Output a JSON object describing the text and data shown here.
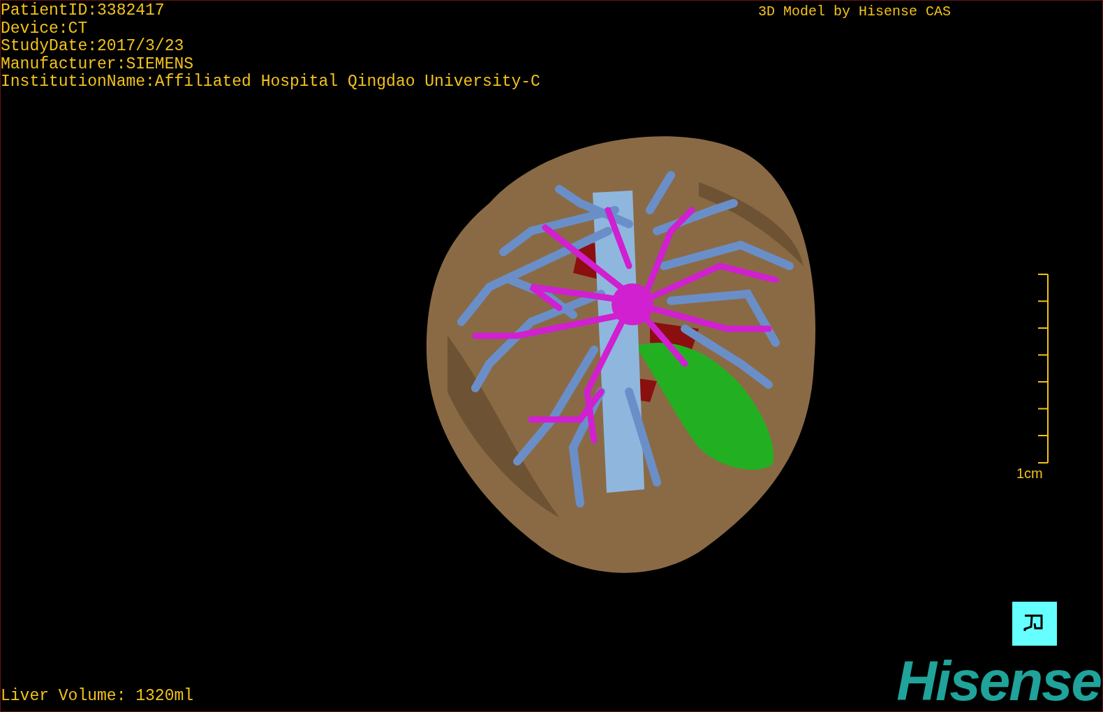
{
  "info_lines": [
    "PatientID:3382417",
    "Device:CT",
    "StudyDate:2017/3/23",
    "Manufacturer:SIEMENS",
    "InstitutionName:Affiliated Hospital Qingdao University-C"
  ],
  "model_caption": "3D Model by Hisense CAS",
  "scale_bar": {
    "label": "1cm"
  },
  "liver_volume": "Liver Volume: 1320ml",
  "logo": "Hisense"
}
